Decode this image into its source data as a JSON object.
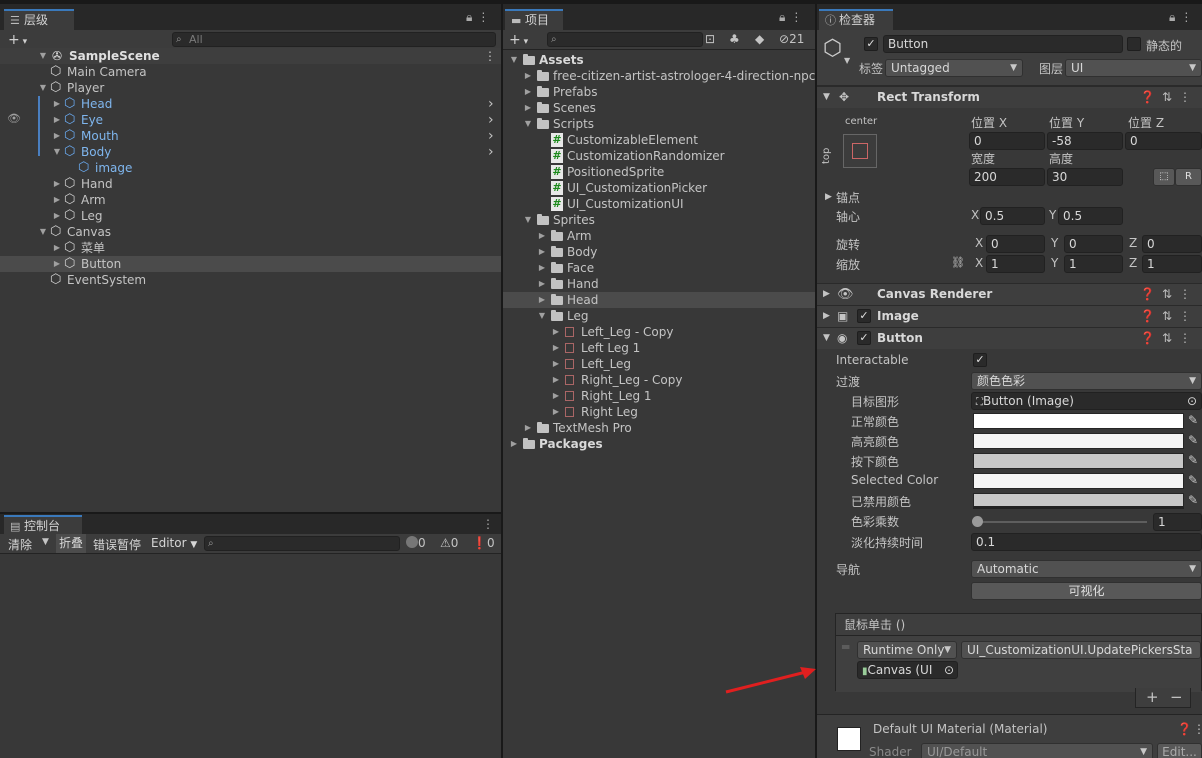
{
  "hierarchy": {
    "tab": "层级",
    "search_placeholder": "All",
    "add": "+",
    "scene": "SampleScene",
    "items": [
      {
        "label": "Main Camera",
        "depth": 1,
        "arrow": "",
        "blue": false,
        "sel": false
      },
      {
        "label": "Player",
        "depth": 1,
        "arrow": "▼",
        "blue": false,
        "sel": false
      },
      {
        "label": "Head",
        "depth": 2,
        "arrow": "▶",
        "blue": true,
        "sel": false
      },
      {
        "label": "Eye",
        "depth": 2,
        "arrow": "▶",
        "blue": true,
        "sel": false
      },
      {
        "label": "Mouth",
        "depth": 2,
        "arrow": "▶",
        "blue": true,
        "sel": false
      },
      {
        "label": "Body",
        "depth": 2,
        "arrow": "▼",
        "blue": true,
        "sel": false
      },
      {
        "label": "image",
        "depth": 3,
        "arrow": "",
        "blue": true,
        "sel": false
      },
      {
        "label": "Hand",
        "depth": 2,
        "arrow": "▶",
        "blue": false,
        "sel": false
      },
      {
        "label": "Arm",
        "depth": 2,
        "arrow": "▶",
        "blue": false,
        "sel": false
      },
      {
        "label": "Leg",
        "depth": 2,
        "arrow": "▶",
        "blue": false,
        "sel": false
      },
      {
        "label": "Canvas",
        "depth": 1,
        "arrow": "▼",
        "blue": false,
        "sel": false
      },
      {
        "label": "菜单",
        "depth": 2,
        "arrow": "▶",
        "blue": false,
        "sel": false
      },
      {
        "label": "Button",
        "depth": 2,
        "arrow": "▶",
        "blue": false,
        "sel": true
      },
      {
        "label": "EventSystem",
        "depth": 1,
        "arrow": "",
        "blue": false,
        "sel": false
      }
    ]
  },
  "console": {
    "tab": "控制台",
    "clear": "清除",
    "collapse": "折叠",
    "error_pause": "错误暂停",
    "editor": "Editor",
    "count_log": "0",
    "count_warn": "0",
    "count_error": "0"
  },
  "project": {
    "tab": "项目",
    "hidden_count": "21",
    "items": [
      {
        "label": "Assets",
        "depth": 0,
        "arrow": "▼",
        "type": "folder",
        "bold": true,
        "sel": false
      },
      {
        "label": "free-citizen-artist-astrologer-4-direction-npc-",
        "depth": 1,
        "arrow": "▶",
        "type": "folder",
        "bold": false,
        "sel": false
      },
      {
        "label": "Prefabs",
        "depth": 1,
        "arrow": "▶",
        "type": "folder",
        "bold": false,
        "sel": false
      },
      {
        "label": "Scenes",
        "depth": 1,
        "arrow": "▶",
        "type": "folder",
        "bold": false,
        "sel": false
      },
      {
        "label": "Scripts",
        "depth": 1,
        "arrow": "▼",
        "type": "folder",
        "bold": false,
        "sel": false
      },
      {
        "label": "CustomizableElement",
        "depth": 2,
        "arrow": "",
        "type": "script",
        "bold": false,
        "sel": false
      },
      {
        "label": "CustomizationRandomizer",
        "depth": 2,
        "arrow": "",
        "type": "script",
        "bold": false,
        "sel": false
      },
      {
        "label": "PositionedSprite",
        "depth": 2,
        "arrow": "",
        "type": "script",
        "bold": false,
        "sel": false
      },
      {
        "label": "UI_CustomizationPicker",
        "depth": 2,
        "arrow": "",
        "type": "script",
        "bold": false,
        "sel": false
      },
      {
        "label": "UI_CustomizationUI",
        "depth": 2,
        "arrow": "",
        "type": "script",
        "bold": false,
        "sel": false
      },
      {
        "label": "Sprites",
        "depth": 1,
        "arrow": "▼",
        "type": "folder",
        "bold": false,
        "sel": false
      },
      {
        "label": "Arm",
        "depth": 2,
        "arrow": "▶",
        "type": "folder",
        "bold": false,
        "sel": false
      },
      {
        "label": "Body",
        "depth": 2,
        "arrow": "▶",
        "type": "folder",
        "bold": false,
        "sel": false
      },
      {
        "label": "Face",
        "depth": 2,
        "arrow": "▶",
        "type": "folder",
        "bold": false,
        "sel": false
      },
      {
        "label": "Hand",
        "depth": 2,
        "arrow": "▶",
        "type": "folder",
        "bold": false,
        "sel": false
      },
      {
        "label": "Head",
        "depth": 2,
        "arrow": "▶",
        "type": "folder",
        "bold": false,
        "sel": true
      },
      {
        "label": "Leg",
        "depth": 2,
        "arrow": "▼",
        "type": "folder",
        "bold": false,
        "sel": false
      },
      {
        "label": "Left_Leg - Copy",
        "depth": 3,
        "arrow": "▶",
        "type": "sprite",
        "bold": false,
        "sel": false
      },
      {
        "label": "Left Leg 1",
        "depth": 3,
        "arrow": "▶",
        "type": "sprite",
        "bold": false,
        "sel": false
      },
      {
        "label": "Left_Leg",
        "depth": 3,
        "arrow": "▶",
        "type": "sprite",
        "bold": false,
        "sel": false
      },
      {
        "label": "Right_Leg - Copy",
        "depth": 3,
        "arrow": "▶",
        "type": "sprite",
        "bold": false,
        "sel": false
      },
      {
        "label": "Right_Leg 1",
        "depth": 3,
        "arrow": "▶",
        "type": "sprite",
        "bold": false,
        "sel": false
      },
      {
        "label": "Right Leg",
        "depth": 3,
        "arrow": "▶",
        "type": "sprite",
        "bold": false,
        "sel": false
      },
      {
        "label": "TextMesh Pro",
        "depth": 1,
        "arrow": "▶",
        "type": "folder",
        "bold": false,
        "sel": false
      },
      {
        "label": "Packages",
        "depth": 0,
        "arrow": "▶",
        "type": "folder",
        "bold": true,
        "sel": false
      }
    ]
  },
  "inspector": {
    "tab": "检查器",
    "object_name": "Button",
    "static_label": "静态的",
    "tag_label": "标签",
    "tag_value": "Untagged",
    "layer_label": "图层",
    "layer_value": "UI",
    "rect_transform": {
      "title": "Rect Transform",
      "anchor_h": "center",
      "anchor_v": "top",
      "pos_x_label": "位置 X",
      "pos_x": "0",
      "pos_y_label": "位置 Y",
      "pos_y": "-58",
      "pos_z_label": "位置 Z",
      "pos_z": "0",
      "width_label": "宽度",
      "width": "200",
      "height_label": "高度",
      "height": "30",
      "anchors_label": "锚点",
      "pivot_label": "轴心",
      "pivot_x": "0.5",
      "pivot_y": "0.5",
      "rotation_label": "旋转",
      "rot_x": "0",
      "rot_y": "0",
      "rot_z": "0",
      "scale_label": "缩放",
      "scale_x": "1",
      "scale_y": "1",
      "scale_z": "1",
      "axis_x": "X",
      "axis_y": "Y",
      "axis_z": "Z",
      "raw_btn": "R"
    },
    "canvas_renderer": {
      "title": "Canvas Renderer"
    },
    "image": {
      "title": "Image"
    },
    "button": {
      "title": "Button",
      "interactable_label": "Interactable",
      "transition_label": "过渡",
      "transition_value": "颜色色彩",
      "target_graphic_label": "目标图形",
      "target_graphic_value": "Button (Image)",
      "normal_label": "正常颜色",
      "highlight_label": "高亮颜色",
      "pressed_label": "按下颜色",
      "selected_label": "Selected Color",
      "disabled_label": "已禁用颜色",
      "multiplier_label": "色彩乘数",
      "multiplier_value": "1",
      "fade_label": "淡化持续时间",
      "fade_value": "0.1",
      "nav_label": "导航",
      "nav_value": "Automatic",
      "visualize": "可视化",
      "onclick_label": "鼠标单击 ()",
      "runtime_value": "Runtime Only",
      "function_value": "UI_CustomizationUI.UpdatePickersSta",
      "object_value": "Canvas (UI",
      "add": "+",
      "remove": "−"
    },
    "material": {
      "title": "Default UI Material (Material)",
      "shader_label": "Shader",
      "shader_value": "UI/Default",
      "edit": "Edit..."
    }
  },
  "colors": {
    "accent": "#3a79bb",
    "prefab_blue": "#7fb6ee",
    "arrow_red": "#e01f1f"
  }
}
